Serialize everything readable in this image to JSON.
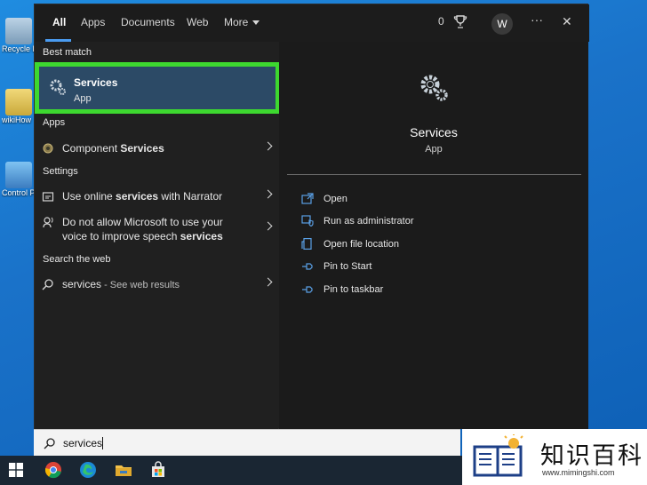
{
  "desktop": {
    "icons": [
      {
        "label": "Recycle Bin"
      },
      {
        "label": "wikiHow"
      },
      {
        "label": "Control Panel"
      }
    ]
  },
  "tabs": [
    {
      "label": "All"
    },
    {
      "label": "Apps"
    },
    {
      "label": "Documents"
    },
    {
      "label": "Web"
    },
    {
      "label": "More"
    }
  ],
  "topbar": {
    "rewards_count": "0",
    "avatar_letter": "W",
    "more_options": "···",
    "close": "✕"
  },
  "best_match": {
    "heading": "Best match",
    "title": "Services",
    "subtitle": "App",
    "highlight_color": "#3dd82f"
  },
  "apps": {
    "heading": "Apps",
    "items": [
      {
        "prefix": "Component ",
        "bold": "Services"
      }
    ]
  },
  "settings": {
    "heading": "Settings",
    "items": [
      {
        "prefix": "Use online ",
        "bold": "services",
        "suffix": " with Narrator"
      },
      {
        "line1": "Do not allow Microsoft to use your",
        "line2_prefix": "voice to improve speech ",
        "line2_bold": "services"
      }
    ]
  },
  "web": {
    "heading": "Search the web",
    "query": "services",
    "see_results": " - See web results"
  },
  "detail": {
    "title": "Services",
    "subtitle": "App",
    "actions": [
      {
        "label": "Open",
        "icon": "open-icon"
      },
      {
        "label": "Run as administrator",
        "icon": "shield-icon"
      },
      {
        "label": "Open file location",
        "icon": "file-location-icon"
      },
      {
        "label": "Pin to Start",
        "icon": "pin-icon"
      },
      {
        "label": "Pin to taskbar",
        "icon": "pin-icon"
      }
    ]
  },
  "search": {
    "value": "services"
  },
  "taskbar": {
    "apps": [
      "windows-start-icon",
      "chrome-icon",
      "edge-icon",
      "file-explorer-icon",
      "store-icon"
    ]
  },
  "watermark": {
    "cn": "知识百科",
    "url": "www.mimingshi.com"
  }
}
